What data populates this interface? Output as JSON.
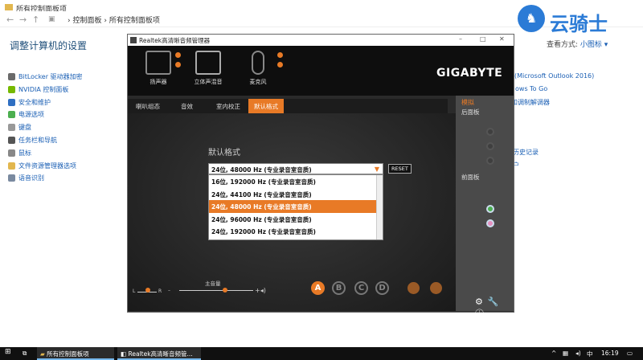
{
  "explorer": {
    "window_title": "所有控制面板项",
    "breadcrumb": [
      "控制面板",
      "所有控制面板项"
    ],
    "heading": "调整计算机的设置",
    "view_by_label": "查看方式:",
    "view_by_value": "小图标",
    "left_items": [
      "BitLocker 驱动器加密",
      "NVIDIA 控制面板",
      "安全和维护",
      "电源选项",
      "键盘",
      "任务栏和导航",
      "鼠标",
      "文件资源管理器选项",
      "语音识别"
    ],
    "right_items": [
      "(Microsoft Outlook 2016)",
      "ows To Go",
      "和调制解调器",
      "历史记录",
      "户"
    ]
  },
  "logo_text": "云骑士",
  "realtek": {
    "title": "Realtek高清晰音频管理器",
    "brand": "GIGABYTE",
    "devices": [
      "扬声器",
      "立体声混音",
      "麦克风"
    ],
    "tabs": [
      "喇叭组态",
      "音效",
      "室内校正",
      "默认格式"
    ],
    "format_label": "默认格式",
    "selected_format": "24位, 48000 Hz (专业录音室音质)",
    "reset_label": "RESET",
    "format_options": [
      "16位, 192000 Hz (专业录音室音质)",
      "24位, 44100 Hz (专业录音室音质)",
      "24位, 48000 Hz (专业录音室音质)",
      "24位, 96000 Hz (专业录音室音质)",
      "24位, 192000 Hz (专业录音室音质)"
    ],
    "volume_label": "主音量",
    "balance_l": "L",
    "balance_r": "R",
    "profiles": [
      "A",
      "B",
      "C",
      "D"
    ],
    "side_title": "模拟",
    "side_back": "后面板",
    "side_front": "前面板"
  },
  "taskbar": {
    "explorer_item": "所有控制面板项",
    "realtek_item": "Realtek高清晰音频管...",
    "ime": "中",
    "clock": "16:19"
  }
}
